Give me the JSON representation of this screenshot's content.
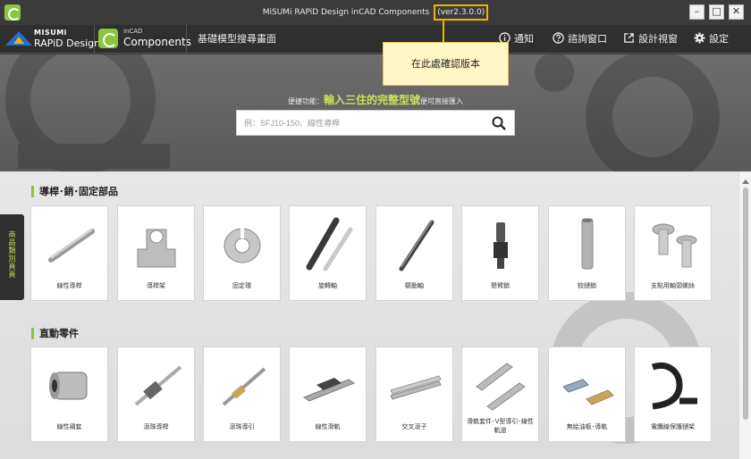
{
  "window": {
    "title": "MiSUMi RAPiD Design inCAD Components",
    "version": "(ver2.3.0.0)",
    "minimize": "–",
    "maximize": "□",
    "close": "✕"
  },
  "header": {
    "misumi_line1": "MISUMi",
    "misumi_line2": "RAPiD Design",
    "incad_line1": "inCAD",
    "incad_line2": "Components",
    "page_title": "基礎模型搜尋畫面",
    "nav": [
      {
        "label": "通知",
        "icon": "info-icon"
      },
      {
        "label": "諮詢窗口",
        "icon": "help-icon"
      },
      {
        "label": "設計視窗",
        "icon": "external-link-icon"
      },
      {
        "label": "設定",
        "icon": "gear-icon"
      }
    ]
  },
  "callout": {
    "text": "在此處確認版本"
  },
  "search": {
    "hint_prefix": "便捷功能：",
    "hint_emphasis": "輸入三住的完整型號",
    "hint_suffix": "便可直接匯入",
    "placeholder": "例：SFJ10-150、線性導桿"
  },
  "side_tab": {
    "label": "商品類別頁頁"
  },
  "sections": [
    {
      "title": "導桿･銷･固定部品",
      "items": [
        "線性導桿",
        "導桿架",
        "固定環",
        "旋轉軸",
        "驅動軸",
        "懸臂銷",
        "鉸鏈銷",
        "支點用軸頭螺絲"
      ]
    },
    {
      "title": "直動零件",
      "items": [
        "線性襯套",
        "滾珠導桿",
        "滾珠導引",
        "線性滑軌",
        "交叉滾子",
        "滑軌套件･V型導引･線性軌道",
        "無給油板･導軌",
        "電纜線保護鏈架"
      ]
    }
  ],
  "colors": {
    "accent_green": "#8cc63f",
    "highlight_yellow": "#f0b400",
    "callout_bg": "#fff8c4"
  }
}
